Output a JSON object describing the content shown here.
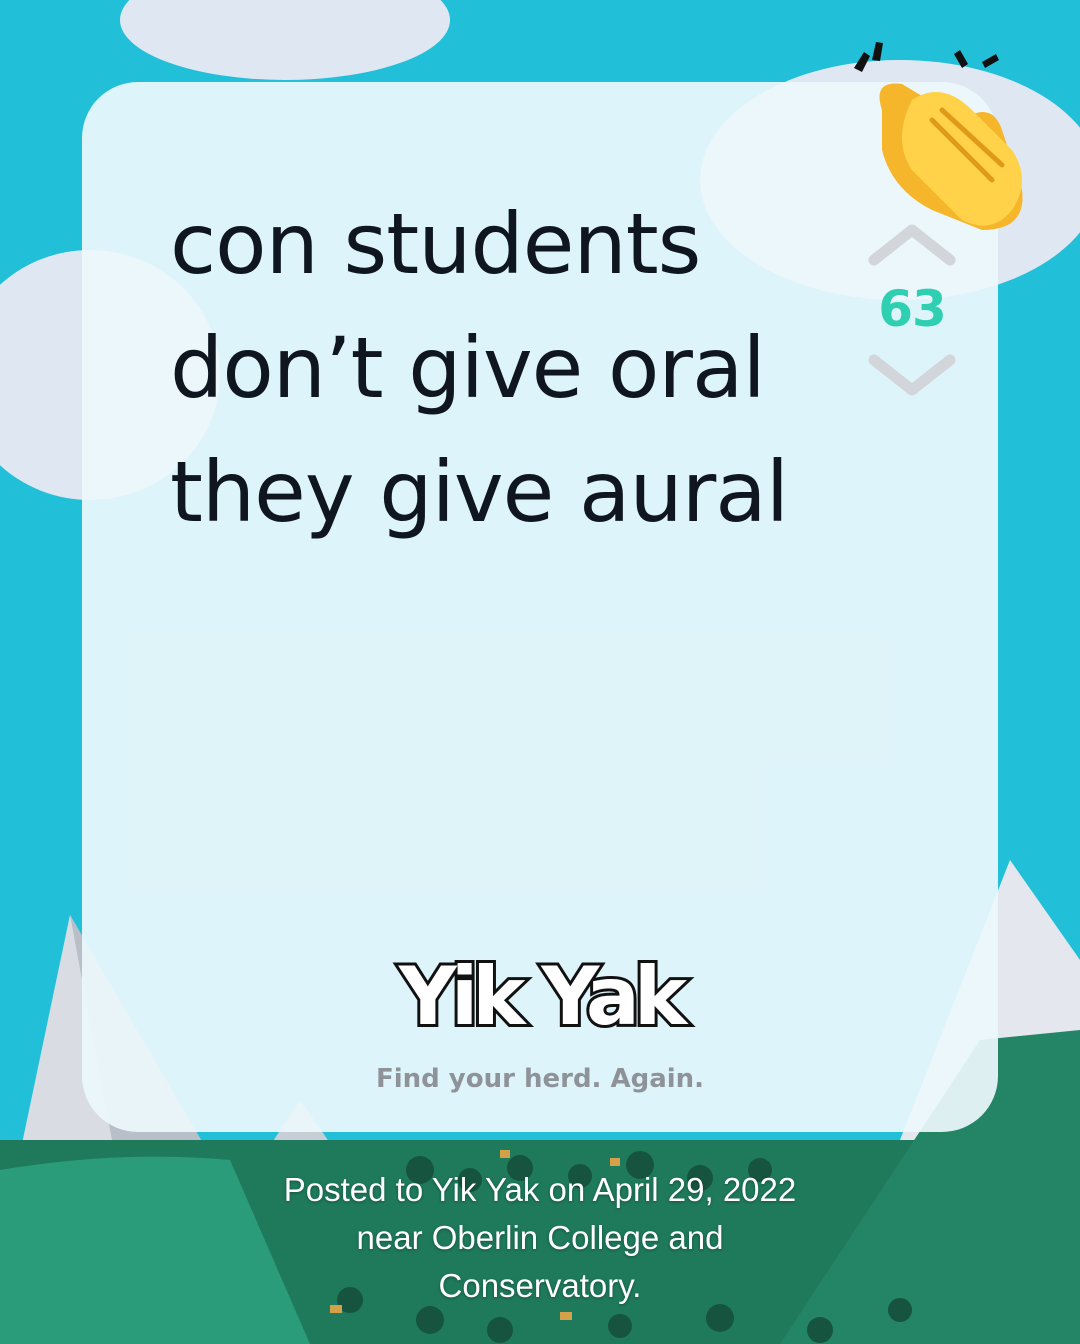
{
  "post": {
    "lines": [
      "con students",
      "don’t give oral",
      "they give aural"
    ]
  },
  "vote": {
    "score": "63",
    "score_color": "#2fd0b2"
  },
  "brand": {
    "logo_text": "Yik Yak",
    "tagline": "Find your herd. Again."
  },
  "footer": {
    "line1": "Posted to Yik Yak on April 29, 2022",
    "line2": "near Oberlin College and",
    "line3": "Conservatory."
  },
  "icons": {
    "upvote": "chevron-up-icon",
    "downvote": "chevron-down-icon",
    "reaction": "clapping-hands-icon"
  },
  "colors": {
    "background": "#22bfd8",
    "card": "#ecf8fc",
    "text": "#0f1620",
    "tagline": "#8e9399"
  }
}
